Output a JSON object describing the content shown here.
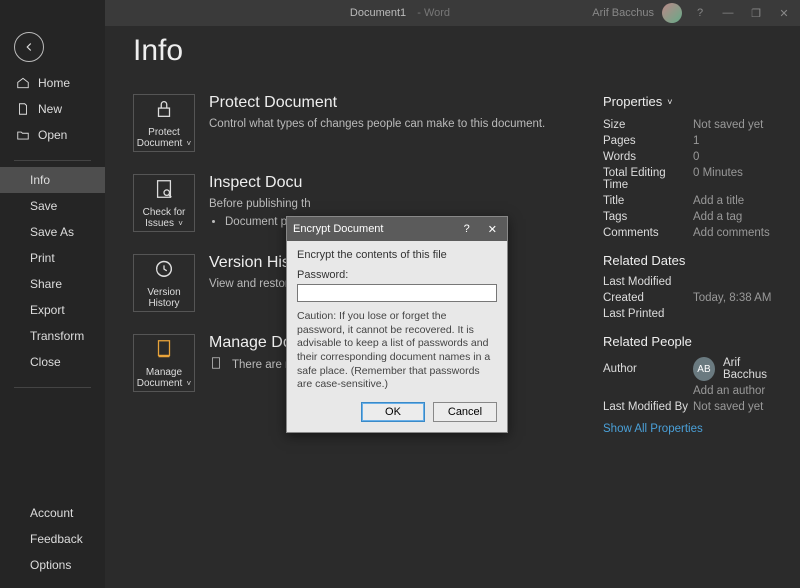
{
  "titlebar": {
    "document": "Document1",
    "app": "Word",
    "username": "Arif Bacchus",
    "help": "?",
    "minimize": "—",
    "restore": "❐",
    "close": "✕"
  },
  "sidebar": {
    "items": [
      {
        "label": "Home",
        "icon": true
      },
      {
        "label": "New",
        "icon": true
      },
      {
        "label": "Open",
        "icon": true
      },
      {
        "label": "Info",
        "icon": false,
        "selected": true
      },
      {
        "label": "Save",
        "icon": false
      },
      {
        "label": "Save As",
        "icon": false
      },
      {
        "label": "Print",
        "icon": false
      },
      {
        "label": "Share",
        "icon": false
      },
      {
        "label": "Export",
        "icon": false
      },
      {
        "label": "Transform",
        "icon": false
      },
      {
        "label": "Close",
        "icon": false
      }
    ],
    "bottom": [
      {
        "label": "Account"
      },
      {
        "label": "Feedback"
      },
      {
        "label": "Options"
      }
    ]
  },
  "page": {
    "title": "Info"
  },
  "sections": {
    "protect": {
      "tile": "Protect Document",
      "title": "Protect Document",
      "desc": "Control what types of changes people can make to this document."
    },
    "inspect": {
      "tile": "Check for Issues",
      "title": "Inspect Docu",
      "desc": "Before publishing th",
      "bullet": "Document pro"
    },
    "version": {
      "tile": "Version History",
      "title": "Version Histo",
      "desc": "View and restore pr"
    },
    "manage": {
      "tile": "Manage Document",
      "title": "Manage Document",
      "desc": "There are no unsaved changes."
    }
  },
  "properties": {
    "heading": "Properties",
    "rows": [
      {
        "k": "Size",
        "v": "Not saved yet"
      },
      {
        "k": "Pages",
        "v": "1"
      },
      {
        "k": "Words",
        "v": "0"
      },
      {
        "k": "Total Editing Time",
        "v": "0 Minutes"
      },
      {
        "k": "Title",
        "v": "Add a title"
      },
      {
        "k": "Tags",
        "v": "Add a tag"
      },
      {
        "k": "Comments",
        "v": "Add comments"
      }
    ],
    "dates_heading": "Related Dates",
    "dates": [
      {
        "k": "Last Modified",
        "v": ""
      },
      {
        "k": "Created",
        "v": "Today, 8:38 AM"
      },
      {
        "k": "Last Printed",
        "v": ""
      }
    ],
    "people_heading": "Related People",
    "author_label": "Author",
    "author_initials": "AB",
    "author_name": "Arif Bacchus",
    "add_author": "Add an author",
    "lastmod_label": "Last Modified By",
    "lastmod_value": "Not saved yet",
    "show_all": "Show All Properties"
  },
  "dialog": {
    "title": "Encrypt Document",
    "help": "?",
    "close": "✕",
    "heading": "Encrypt the contents of this file",
    "password_label": "Password:",
    "password_value": "",
    "caution": "Caution: If you lose or forget the password, it cannot be recovered. It is advisable to keep a list of passwords and their corresponding document names in a safe place. (Remember that passwords are case-sensitive.)",
    "ok": "OK",
    "cancel": "Cancel"
  }
}
